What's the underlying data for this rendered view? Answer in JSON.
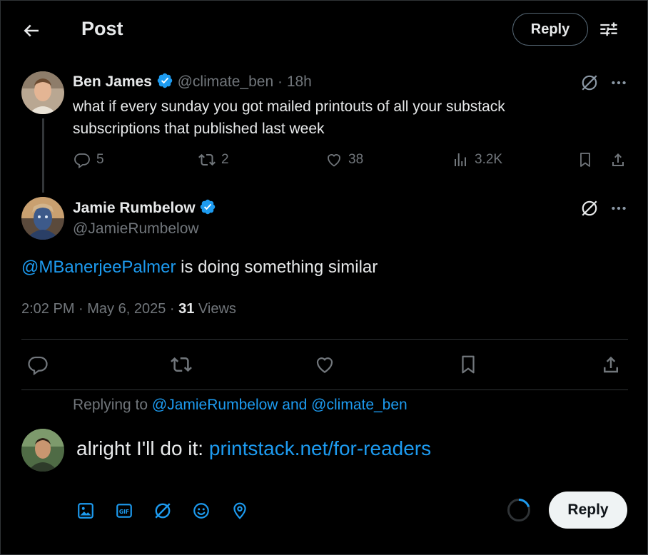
{
  "header": {
    "title": "Post",
    "reply_button": "Reply"
  },
  "parent_tweet": {
    "author_name": "Ben James",
    "handle": "@climate_ben",
    "time": "· 18h",
    "text": "what if every sunday you got mailed printouts of all your substack subscriptions that published last week",
    "stats": {
      "replies": "5",
      "reposts": "2",
      "likes": "38",
      "views": "3.2K"
    }
  },
  "main_tweet": {
    "author_name": "Jamie Rumbelow",
    "handle": "@JamieRumbelow",
    "mention": "@MBanerjeePalmer",
    "text": " is doing something similar",
    "timestamp": "2:02 PM · May 6, 2025 · ",
    "views_count": "31",
    "views_label": " Views"
  },
  "compose": {
    "replying_to_prefix": "Replying to ",
    "replying_to_user1": "@JamieRumbelow",
    "replying_to_and": " and ",
    "replying_to_user2": "@climate_ben",
    "text_prefix": "alright I'll do it: ",
    "link": "printstack.net/for-readers",
    "reply_button": "Reply",
    "char_progress": 0.2
  },
  "colors": {
    "accent": "#1d9bf0",
    "muted": "#71767b",
    "background": "#000000"
  }
}
